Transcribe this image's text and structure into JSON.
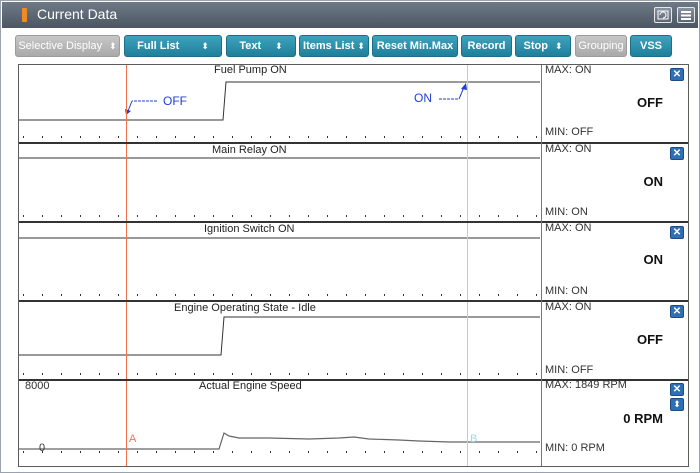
{
  "window": {
    "title": "Current Data",
    "accent": "#f08a24",
    "retry_icon": "retry-icon",
    "menu_icon": "menu-icon"
  },
  "toolbar": {
    "selective_display": "Selective Display",
    "full_list": "Full List",
    "text": "Text",
    "items_list": "Items List",
    "reset_minmax": "Reset Min.Max",
    "record": "Record",
    "stop": "Stop",
    "grouping": "Grouping",
    "vss": "VSS",
    "caret": "⬍"
  },
  "cursors": {
    "a_label": "A",
    "b_label": "B",
    "a_color": "#f0724f",
    "b_color": "#8ee1ec"
  },
  "annotations": {
    "off": "OFF",
    "on": "ON"
  },
  "panels": [
    {
      "title": "Fuel Pump ON",
      "max": "MAX: ON",
      "min": "MIN: OFF",
      "value": "OFF"
    },
    {
      "title": "Main Relay ON",
      "max": "MAX: ON",
      "min": "MIN: ON",
      "value": "ON"
    },
    {
      "title": "Ignition Switch ON",
      "max": "MAX: ON",
      "min": "MIN: ON",
      "value": "ON"
    },
    {
      "title": "Engine Operating State - Idle",
      "max": "MAX: ON",
      "min": "MIN: OFF",
      "value": "OFF"
    },
    {
      "title": "Actual Engine Speed",
      "max": "MAX:  1849 RPM",
      "min": "MIN:     0 RPM",
      "value": "0 RPM",
      "y_top": "8000",
      "y_bottom": "0"
    }
  ]
}
